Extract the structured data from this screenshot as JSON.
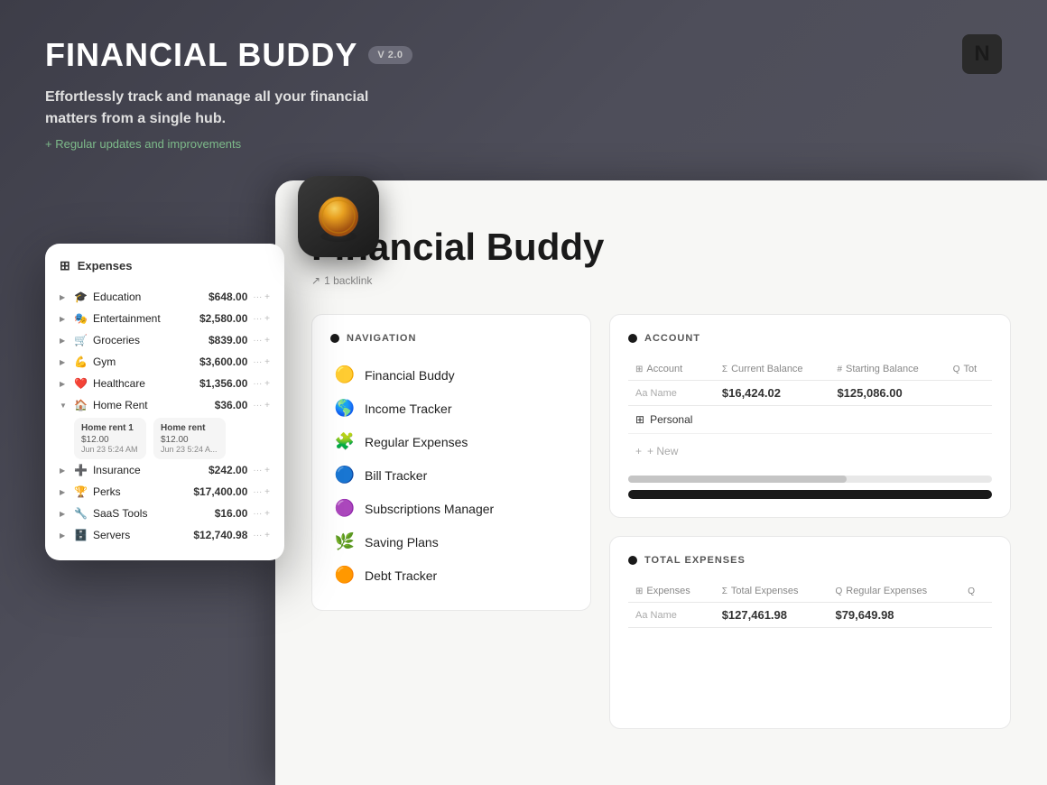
{
  "app": {
    "title": "FINANCIAL BUDDY",
    "version": "V 2.0",
    "tagline": "Effortlessly track and manage all your financial matters from a single hub.",
    "updates": "+ Regular updates and improvements"
  },
  "expenses_panel": {
    "header": "Expenses",
    "items": [
      {
        "icon": "🎓",
        "name": "Education",
        "amount": "$648.00",
        "expanded": false
      },
      {
        "icon": "🎭",
        "name": "Entertainment",
        "amount": "$2,580.00",
        "expanded": false
      },
      {
        "icon": "🛒",
        "name": "Groceries",
        "amount": "$839.00",
        "expanded": false
      },
      {
        "icon": "💪",
        "name": "Gym",
        "amount": "$3,600.00",
        "expanded": false
      },
      {
        "icon": "❤️",
        "name": "Healthcare",
        "amount": "$1,356.00",
        "expanded": false
      },
      {
        "icon": "🏠",
        "name": "Home Rent",
        "amount": "$36.00",
        "expanded": true
      },
      {
        "icon": "➕",
        "name": "Insurance",
        "amount": "$242.00",
        "expanded": false
      },
      {
        "icon": "🏆",
        "name": "Perks",
        "amount": "$17,400.00",
        "expanded": false
      },
      {
        "icon": "🔧",
        "name": "SaaS Tools",
        "amount": "$16.00",
        "expanded": false
      },
      {
        "icon": "🗄️",
        "name": "Servers",
        "amount": "$12,740.98",
        "expanded": false
      }
    ],
    "subrows": [
      {
        "title": "Home rent 1",
        "amount": "$12.00",
        "date": "Jun 23 5:24 AM"
      },
      {
        "title": "Home rent",
        "amount": "$12.00",
        "date": "Jun 23 5:24 A..."
      }
    ]
  },
  "page": {
    "title": "Financial Buddy",
    "backlink": "1 backlink"
  },
  "navigation": {
    "header": "NAVIGATION",
    "items": [
      {
        "emoji": "🟡",
        "label": "Financial Buddy"
      },
      {
        "emoji": "🌎",
        "label": "Income Tracker"
      },
      {
        "emoji": "🧩",
        "label": "Regular Expenses"
      },
      {
        "emoji": "🔵",
        "label": "Bill Tracker"
      },
      {
        "emoji": "🟣",
        "label": "Subscriptions Manager"
      },
      {
        "emoji": "🌿",
        "label": "Saving Plans"
      },
      {
        "emoji": "🟠",
        "label": "Debt Tracker"
      }
    ]
  },
  "account": {
    "header": "ACCOUNT",
    "table": {
      "columns": [
        "Account",
        "Current Balance",
        "Starting Balance",
        "Tot"
      ],
      "col_icons": [
        "⊞",
        "Σ",
        "#",
        "Q"
      ],
      "sub_cols": [
        "Aa Name"
      ],
      "rows": [
        {
          "name": "Personal",
          "current_balance": "$16,424.02",
          "starting_balance": "$125,086.00"
        }
      ],
      "add_label": "+ New"
    }
  },
  "total_expenses": {
    "header": "TOTAL EXPENSES",
    "table": {
      "columns": [
        "Expenses",
        "Total Expenses",
        "Regular Expenses",
        ""
      ],
      "col_icons": [
        "⊞",
        "Σ",
        "Q",
        "Q"
      ],
      "sub_cols": [
        "Aa Name"
      ],
      "values": {
        "total_expenses": "$127,461.98",
        "regular_expenses": "$79,649.98"
      }
    }
  },
  "icons": {
    "notion": "N",
    "grid": "⊞",
    "expand": "↗",
    "plus": "+"
  },
  "colors": {
    "background": "#4a4a55",
    "panel_bg": "#f7f7f5",
    "accent_green": "#7dba8a",
    "dark": "#1a1a1a",
    "white": "#ffffff"
  }
}
